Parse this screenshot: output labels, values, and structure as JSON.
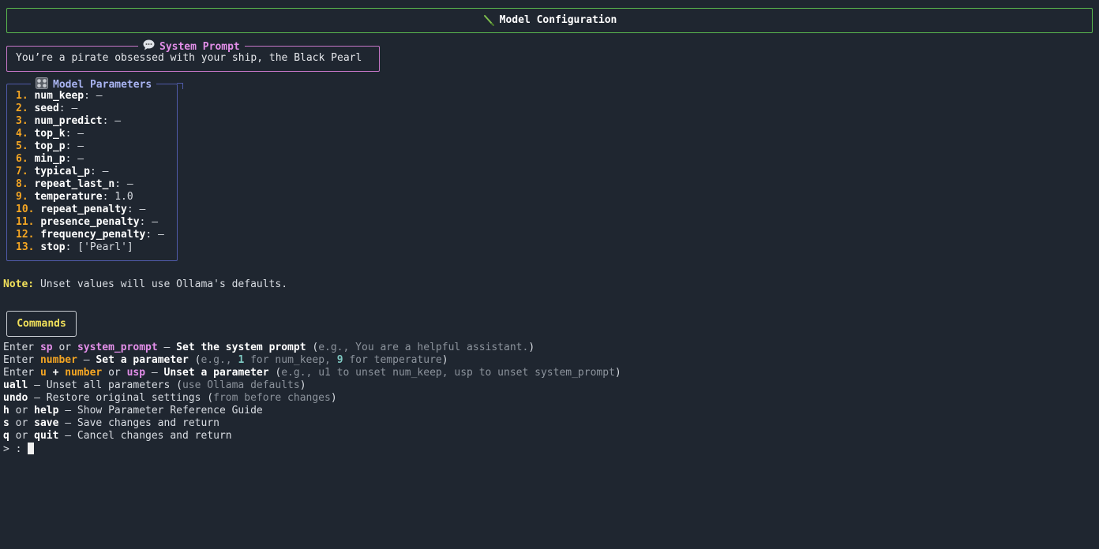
{
  "header": {
    "title": "Model Configuration",
    "icon": "brush-icon"
  },
  "system_prompt": {
    "title": "System Prompt",
    "icon": "speech-bubble-icon",
    "value": "You’re a pirate obsessed with your ship, the Black Pearl"
  },
  "model_parameters": {
    "title": "Model Parameters",
    "icon": "control-knobs-icon",
    "items": [
      {
        "num": "1.",
        "name": "num_keep",
        "value": "–"
      },
      {
        "num": "2.",
        "name": "seed",
        "value": "–"
      },
      {
        "num": "3.",
        "name": "num_predict",
        "value": "–"
      },
      {
        "num": "4.",
        "name": "top_k",
        "value": "–"
      },
      {
        "num": "5.",
        "name": "top_p",
        "value": "–"
      },
      {
        "num": "6.",
        "name": "min_p",
        "value": "–"
      },
      {
        "num": "7.",
        "name": "typical_p",
        "value": "–"
      },
      {
        "num": "8.",
        "name": "repeat_last_n",
        "value": "–"
      },
      {
        "num": "9.",
        "name": "temperature",
        "value": "1.0"
      },
      {
        "num": "10.",
        "name": "repeat_penalty",
        "value": "–"
      },
      {
        "num": "11.",
        "name": "presence_penalty",
        "value": "–"
      },
      {
        "num": "12.",
        "name": "frequency_penalty",
        "value": "–"
      },
      {
        "num": "13.",
        "name": "stop",
        "value": "['Pearl']"
      }
    ]
  },
  "note": {
    "label": "Note:",
    "text": " Unset values will use Ollama's defaults."
  },
  "commands": {
    "title": "Commands",
    "l1": {
      "a": "Enter ",
      "b": "sp",
      "c": " or ",
      "d": "system_prompt",
      "e": " – ",
      "f": "Set the system prompt",
      "g": " (",
      "h": "e.g., You are a helpful assistant.",
      "i": ")"
    },
    "l2": {
      "a": "Enter ",
      "b": "number",
      "c": " – ",
      "d": "Set a parameter",
      "e": " (",
      "f": "e.g., ",
      "g": "1",
      "h": " for num_keep, ",
      "i": "9",
      "j": " for temperature",
      "k": ")"
    },
    "l3": {
      "a": "Enter ",
      "b": "u",
      "c": " + ",
      "d": "number",
      "e": " or ",
      "f": "usp",
      "g": " – ",
      "h": "Unset a parameter",
      "i": " (",
      "j": "e.g., u1 to unset num_keep, usp to unset system_prompt",
      "k": ")"
    },
    "l4": {
      "a": "uall",
      "b": " – Unset all parameters ",
      "c": "(",
      "d": "use Ollama defaults",
      "e": ")"
    },
    "l5": {
      "a": "undo",
      "b": " – Restore original settings ",
      "c": "(",
      "d": "from before changes",
      "e": ")"
    },
    "l6": {
      "a": "h",
      "b": " or ",
      "c": "help",
      "d": " – Show Parameter Reference Guide"
    },
    "l7": {
      "a": "s",
      "b": " or ",
      "c": "save",
      "d": " – Save changes and return"
    },
    "l8": {
      "a": "q",
      "b": " or ",
      "c": "quit",
      "d": " – Cancel changes and return"
    },
    "prompt": "> : "
  }
}
